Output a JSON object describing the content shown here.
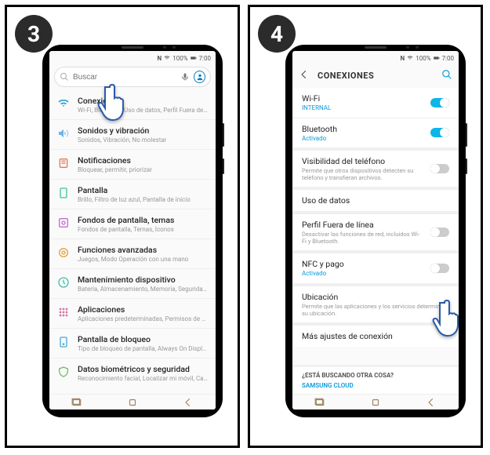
{
  "steps": {
    "left": "3",
    "right": "4"
  },
  "status": {
    "nfc": "N",
    "signal": "100%",
    "time": "7:00"
  },
  "search": {
    "placeholder": "Buscar"
  },
  "settings": [
    {
      "icon": "wifi",
      "iconColor": "#2aa8d8",
      "title": "Conexiones",
      "sub": "Wi-Fi, Bluetooth, Uso de datos, Perfil Fuera de lí..."
    },
    {
      "icon": "sound",
      "iconColor": "#6fb5e6",
      "title": "Sonidos y vibración",
      "sub": "Sonidos, Vibración, No molestar"
    },
    {
      "icon": "notif",
      "iconColor": "#e67a5a",
      "title": "Notificaciones",
      "sub": "Bloquear, permitir, priorizar"
    },
    {
      "icon": "display",
      "iconColor": "#3fc49a",
      "title": "Pantalla",
      "sub": "Brillo, Filtro de luz azul, Pantalla de inicio"
    },
    {
      "icon": "wall",
      "iconColor": "#c86fc8",
      "title": "Fondos de pantalla, temas",
      "sub": "Fondos de pantalla, Temas, Íconos"
    },
    {
      "icon": "adv",
      "iconColor": "#e6a03f",
      "title": "Funciones avanzadas",
      "sub": "Juegos, Modo Operación con una mano"
    },
    {
      "icon": "maint",
      "iconColor": "#44c0a8",
      "title": "Mantenimiento dispositivo",
      "sub": "Batería, Almacenamiento, Memoria, Seguridad..."
    },
    {
      "icon": "apps",
      "iconColor": "#d66fa3",
      "title": "Aplicaciones",
      "sub": "Aplicaciones predeterminadas, Permisos de ap..."
    },
    {
      "icon": "lock",
      "iconColor": "#4aa8d8",
      "title": "Pantalla de bloqueo",
      "sub": "Tipo de bloqueo de pantalla, Always On Display..."
    },
    {
      "icon": "bio",
      "iconColor": "#6cc06c",
      "title": "Datos biométricos y seguridad",
      "sub": "Reconocimiento facial, Localizar mi móvil, Carp..."
    }
  ],
  "connections": {
    "title": "CONEXIONES",
    "items": [
      {
        "title": "Wi-Fi",
        "sub": "INTERNAL",
        "subActive": true,
        "toggle": "on"
      },
      {
        "title": "Bluetooth",
        "sub": "Activado",
        "subActive": true,
        "toggle": "on"
      },
      {
        "gap": true
      },
      {
        "title": "Visibilidad del teléfono",
        "sub": "Permite que otros dispositivos detecten su teléfono y transfieran archivos.",
        "toggle": "off"
      },
      {
        "gap": true
      },
      {
        "title": "Uso de datos"
      },
      {
        "gap": true
      },
      {
        "title": "Perfil Fuera de línea",
        "sub": "Desactivar las funciones de red, incluidos Wi-Fi y Bluetooth.",
        "toggle": "off"
      },
      {
        "gap": true
      },
      {
        "title": "NFC y pago",
        "sub": "Activado",
        "subActive": true,
        "toggle": "off"
      },
      {
        "gap": true
      },
      {
        "title": "Ubicación",
        "sub": "Permite que las aplicaciones y los servicios determinen su ubicación."
      },
      {
        "gap": true
      },
      {
        "title": "Más ajustes de conexión"
      }
    ],
    "footer": {
      "question": "¿ESTÁ BUSCANDO OTRA COSA?",
      "link": "SAMSUNG CLOUD"
    }
  }
}
